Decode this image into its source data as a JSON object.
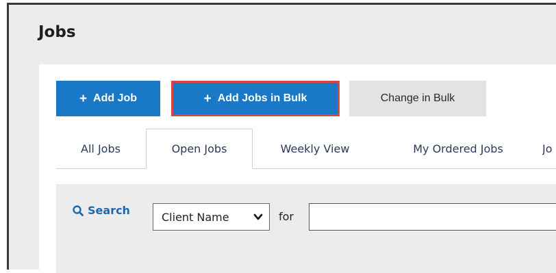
{
  "page": {
    "title": "Jobs"
  },
  "toolbar": {
    "add_job": "Add Job",
    "add_jobs_bulk": "Add Jobs in Bulk",
    "change_bulk": "Change in Bulk"
  },
  "tabs": [
    {
      "label": "All Jobs"
    },
    {
      "label": "Open Jobs"
    },
    {
      "label": "Weekly View"
    },
    {
      "label": "My Ordered Jobs"
    },
    {
      "label": "Jo"
    }
  ],
  "search": {
    "label": "Search",
    "field_select_value": "Client Name",
    "for_label": "for",
    "query_value": ""
  },
  "colors": {
    "primary": "#1a79c6",
    "highlight": "#d84545",
    "panel": "#ececec"
  }
}
